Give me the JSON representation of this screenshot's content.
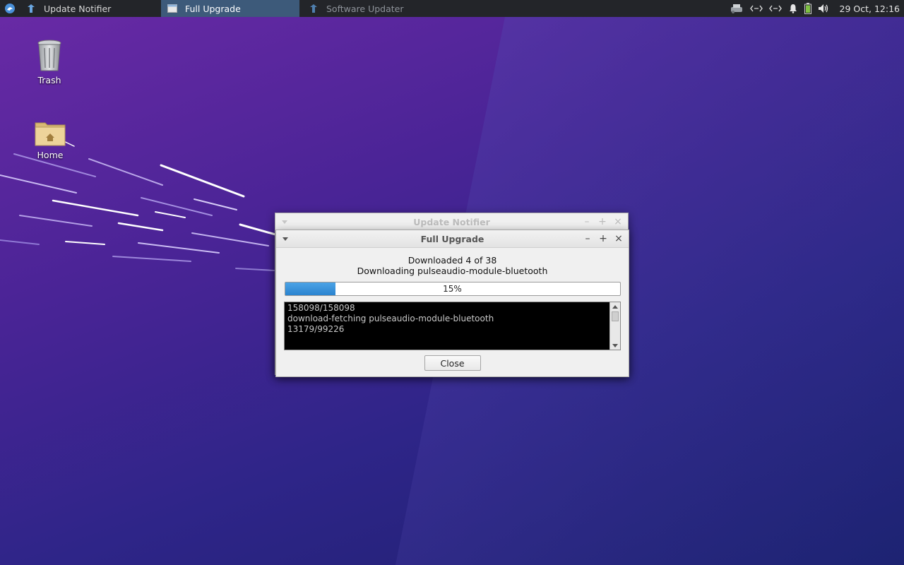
{
  "taskbar": {
    "tasks": [
      {
        "label": "Update Notifier",
        "state": "normal"
      },
      {
        "label": "Full Upgrade",
        "state": "active"
      },
      {
        "label": "Software Updater",
        "state": "dim"
      }
    ],
    "clock": "29 Oct, 12:16"
  },
  "desktop": {
    "icons": [
      {
        "label": "Trash"
      },
      {
        "label": "Home"
      }
    ]
  },
  "back_window": {
    "title": "Update Notifier"
  },
  "upgrade_window": {
    "title": "Full Upgrade",
    "status_line1": "Downloaded 4 of 38",
    "status_line2": "Downloading pulseaudio-module-bluetooth",
    "progress_percent": 15,
    "progress_label": "15%",
    "terminal_lines": [
      "158098/158098",
      "download-fetching pulseaudio-module-bluetooth",
      "13179/99226"
    ],
    "close_label": "Close"
  },
  "colors": {
    "panel_bg": "#232529",
    "active_task": "#3d5a7a",
    "progress_fill": "#2a83cf",
    "desktop_purple": "#4a2496"
  }
}
